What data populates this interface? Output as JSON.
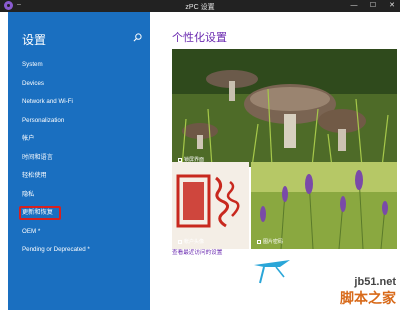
{
  "titlebar": {
    "dash": "–",
    "title": "zPC 设置",
    "minimize": "—",
    "maximize": "☐",
    "close": "✕"
  },
  "sidebar": {
    "title": "设置",
    "search_icon": "search-icon",
    "items": [
      {
        "label": "System"
      },
      {
        "label": "Devices"
      },
      {
        "label": "Network and Wi-Fi"
      },
      {
        "label": "Personalization"
      },
      {
        "label": "帐户"
      },
      {
        "label": "时间和语言"
      },
      {
        "label": "轻松使用"
      },
      {
        "label": "隐私"
      },
      {
        "label": "更新和恢复"
      },
      {
        "label": "OEM *"
      },
      {
        "label": "Pending or Deprecated *"
      }
    ],
    "active_index": 8,
    "highlight_color": "#d8201e",
    "background_color": "#1a6fc0"
  },
  "main": {
    "title": "个性化设置",
    "accent_color": "#6a2ab0",
    "tiles": [
      {
        "label": "锁屏界面"
      },
      {
        "label": "帐户头像"
      },
      {
        "label": "图片密码"
      }
    ],
    "seal_text": "高风清逸",
    "link": "查看最近访问的设置"
  },
  "watermark": {
    "line1": "jb51.net",
    "line2": "脚本之家"
  }
}
